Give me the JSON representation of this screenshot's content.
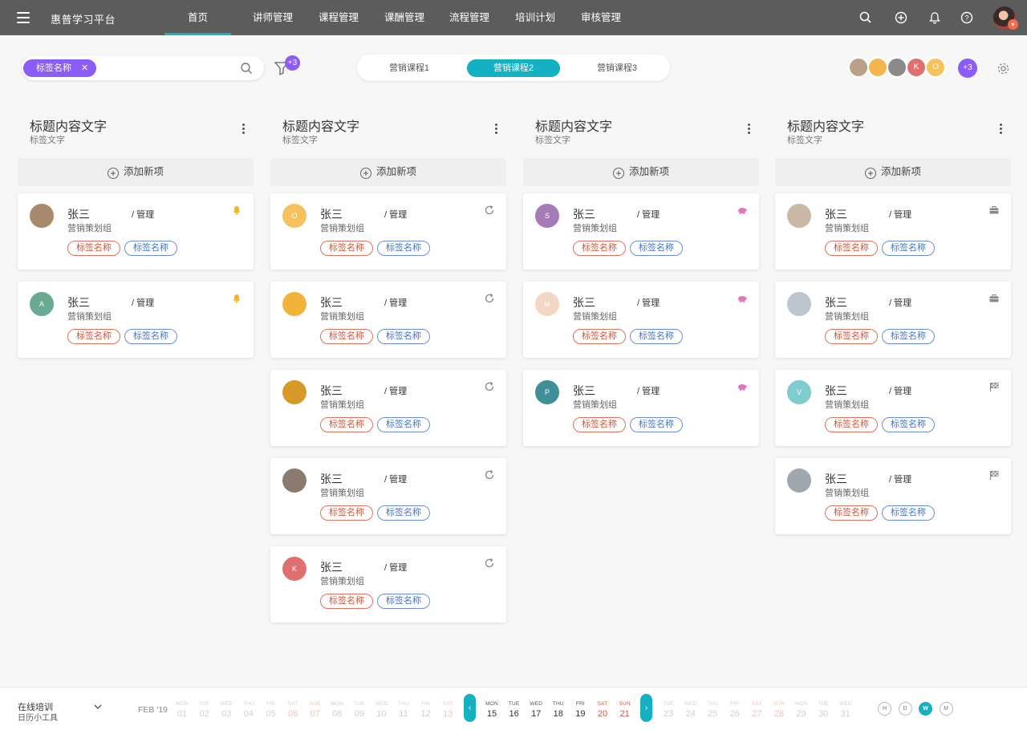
{
  "app": {
    "title": "惠普学习平台"
  },
  "nav": [
    {
      "label": "首页",
      "active": true
    },
    {
      "label": "讲师管理"
    },
    {
      "label": "课程管理"
    },
    {
      "label": "课酬管理"
    },
    {
      "label": "流程管理"
    },
    {
      "label": "培训计划"
    },
    {
      "label": "审核管理"
    }
  ],
  "toolbar": {
    "filter_chip": "标签名称",
    "filter_count": "+3",
    "tabs": [
      "营销课程1",
      "营销课程2",
      "营销课程3"
    ],
    "active_tab": 1,
    "team_extra": "+3",
    "team": [
      {
        "initial": "",
        "color": "#b9a18a"
      },
      {
        "initial": "",
        "color": "#f3b64d"
      },
      {
        "initial": "",
        "color": "#8a8a8a"
      },
      {
        "initial": "K",
        "color": "#e07070"
      },
      {
        "initial": "O",
        "color": "#f6c25d"
      }
    ]
  },
  "columns": [
    {
      "title": "标题内容文字",
      "subtitle": "标签文字",
      "add_label": "添加新项",
      "cards": [
        {
          "name": "张三",
          "role": "/ 管理",
          "group": "营销策划组",
          "tags": [
            "标签名称",
            "标签名称"
          ],
          "icon": "bell-icon",
          "avatar": {
            "initial": "",
            "color": "#a9896b"
          }
        },
        {
          "name": "张三",
          "role": "/ 管理",
          "group": "营销策划组",
          "tags": [
            "标签名称",
            "标签名称"
          ],
          "icon": "bell-icon",
          "avatar": {
            "initial": "A",
            "color": "#6aaa92"
          }
        }
      ]
    },
    {
      "title": "标题内容文字",
      "subtitle": "标签文字",
      "add_label": "添加新项",
      "cards": [
        {
          "name": "张三",
          "role": "/ 管理",
          "group": "营销策划组",
          "tags": [
            "标签名称",
            "标签名称"
          ],
          "icon": "refresh-icon",
          "avatar": {
            "initial": "O",
            "color": "#f6c25d"
          }
        },
        {
          "name": "张三",
          "role": "/ 管理",
          "group": "营销策划组",
          "tags": [
            "标签名称",
            "标签名称"
          ],
          "icon": "refresh-icon",
          "avatar": {
            "initial": "",
            "color": "#f1b33a"
          }
        },
        {
          "name": "张三",
          "role": "/ 管理",
          "group": "营销策划组",
          "tags": [
            "标签名称",
            "标签名称"
          ],
          "icon": "refresh-icon",
          "avatar": {
            "initial": "",
            "color": "#d79a2a"
          }
        },
        {
          "name": "张三",
          "role": "/ 管理",
          "group": "营销策划组",
          "tags": [
            "标签名称",
            "标签名称"
          ],
          "icon": "refresh-icon",
          "avatar": {
            "initial": "",
            "color": "#8a7a70"
          }
        },
        {
          "name": "张三",
          "role": "/ 管理",
          "group": "营销策划组",
          "tags": [
            "标签名称",
            "标签名称"
          ],
          "icon": "refresh-icon",
          "avatar": {
            "initial": "K",
            "color": "#e07070"
          }
        }
      ]
    },
    {
      "title": "标题内容文字",
      "subtitle": "标签文字",
      "add_label": "添加新项",
      "cards": [
        {
          "name": "张三",
          "role": "/ 管理",
          "group": "营销策划组",
          "tags": [
            "标签名称",
            "标签名称"
          ],
          "icon": "piggy-bank-icon",
          "avatar": {
            "initial": "S",
            "color": "#a57bb5"
          }
        },
        {
          "name": "张三",
          "role": "/ 管理",
          "group": "营销策划组",
          "tags": [
            "标签名称",
            "标签名称"
          ],
          "icon": "piggy-bank-icon",
          "avatar": {
            "initial": "M",
            "color": "#f3d6c4"
          }
        },
        {
          "name": "张三",
          "role": "/ 管理",
          "group": "营销策划组",
          "tags": [
            "标签名称",
            "标签名称"
          ],
          "icon": "piggy-bank-icon",
          "avatar": {
            "initial": "P",
            "color": "#3f8f98"
          }
        }
      ]
    },
    {
      "title": "标题内容文字",
      "subtitle": "标签文字",
      "add_label": "添加新项",
      "cards": [
        {
          "name": "张三",
          "role": "/ 管理",
          "group": "营销策划组",
          "tags": [
            "标签名称",
            "标签名称"
          ],
          "icon": "briefcase-icon",
          "avatar": {
            "initial": "",
            "color": "#c9b8a6"
          }
        },
        {
          "name": "张三",
          "role": "/ 管理",
          "group": "营销策划组",
          "tags": [
            "标签名称",
            "标签名称"
          ],
          "icon": "briefcase-icon",
          "avatar": {
            "initial": "",
            "color": "#bcc6cc"
          }
        },
        {
          "name": "张三",
          "role": "/ 管理",
          "group": "营销策划组",
          "tags": [
            "标签名称",
            "标签名称"
          ],
          "icon": "checkered-flag-icon",
          "avatar": {
            "initial": "V",
            "color": "#7fcbd0"
          }
        },
        {
          "name": "张三",
          "role": "/ 管理",
          "group": "营销策划组",
          "tags": [
            "标签名称",
            "标签名称"
          ],
          "icon": "checkered-flag-icon",
          "avatar": {
            "initial": "",
            "color": "#9fa7b0"
          }
        }
      ]
    }
  ],
  "footer": {
    "title": "在线培训",
    "subtitle": "日历小工具",
    "month": "FEB '19",
    "days_before": [
      {
        "dn": "MON",
        "dd": "01"
      },
      {
        "dn": "TUE",
        "dd": "02"
      },
      {
        "dn": "WED",
        "dd": "03"
      },
      {
        "dn": "THU",
        "dd": "04"
      },
      {
        "dn": "FRI",
        "dd": "05"
      },
      {
        "dn": "SAT",
        "dd": "06",
        "wk": true
      },
      {
        "dn": "SUN",
        "dd": "07",
        "wk": true
      },
      {
        "dn": "MON",
        "dd": "08"
      },
      {
        "dn": "TUE",
        "dd": "09"
      },
      {
        "dn": "WED",
        "dd": "10"
      },
      {
        "dn": "THU",
        "dd": "11"
      },
      {
        "dn": "FRI",
        "dd": "12"
      },
      {
        "dn": "SAT",
        "dd": "13",
        "wk": true
      }
    ],
    "days_active": [
      {
        "dn": "MON",
        "dd": "15"
      },
      {
        "dn": "TUE",
        "dd": "16"
      },
      {
        "dn": "WED",
        "dd": "17"
      },
      {
        "dn": "THU",
        "dd": "18"
      },
      {
        "dn": "FRI",
        "dd": "19"
      },
      {
        "dn": "SAT",
        "dd": "20",
        "wk": true
      },
      {
        "dn": "SUN",
        "dd": "21",
        "wk": true
      }
    ],
    "days_after": [
      {
        "dn": "TUE",
        "dd": "23"
      },
      {
        "dn": "WED",
        "dd": "24"
      },
      {
        "dn": "THU",
        "dd": "25"
      },
      {
        "dn": "FRI",
        "dd": "26"
      },
      {
        "dn": "SAT",
        "dd": "27",
        "wk": true
      },
      {
        "dn": "SUN",
        "dd": "28",
        "wk": true
      },
      {
        "dn": "MON",
        "dd": "29"
      },
      {
        "dn": "TUE",
        "dd": "30"
      },
      {
        "dn": "WED",
        "dd": "31"
      }
    ],
    "view_buttons": [
      "H",
      "D",
      "W",
      "M"
    ],
    "active_view": 2
  },
  "colors": {
    "accent": "#13b1c1",
    "purple": "#8b5cf6",
    "topbar": "#5c5c5c"
  }
}
